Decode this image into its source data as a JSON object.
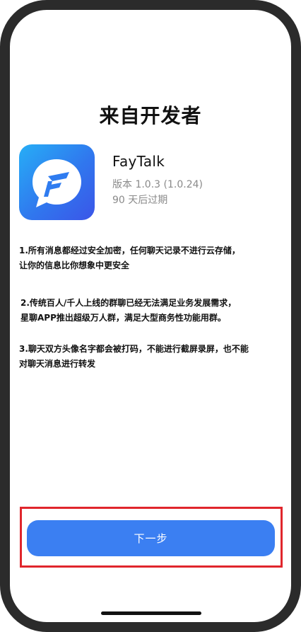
{
  "page": {
    "title": "来自开发者"
  },
  "app": {
    "name": "FayTalk",
    "version": "版本 1.0.3 (1.0.24)",
    "expiry": "90 天后过期",
    "icon": "faytalk-app-icon",
    "icon_colors": [
      "#27aef6",
      "#3077ee",
      "#3b55e8"
    ]
  },
  "notes": [
    {
      "text": "1.所有消息都经过安全加密，任何聊天记录不进行云存储，\n让你的信息比你想象中更安全"
    },
    {
      "text": "2.传统百人/千人上线的群聊已经无法满足业务发展需求，\n星聊APP推出超级万人群，满足大型商务性功能用群。"
    },
    {
      "text": "3.聊天双方头像名字都会被打码，不能进行截屏录屏，也不能\n对聊天消息进行转发"
    }
  ],
  "actions": {
    "next_label": "下一步"
  },
  "colors": {
    "accent": "#3b7ff2",
    "highlight": "#e0262c",
    "frame": "#2b2b2b"
  }
}
